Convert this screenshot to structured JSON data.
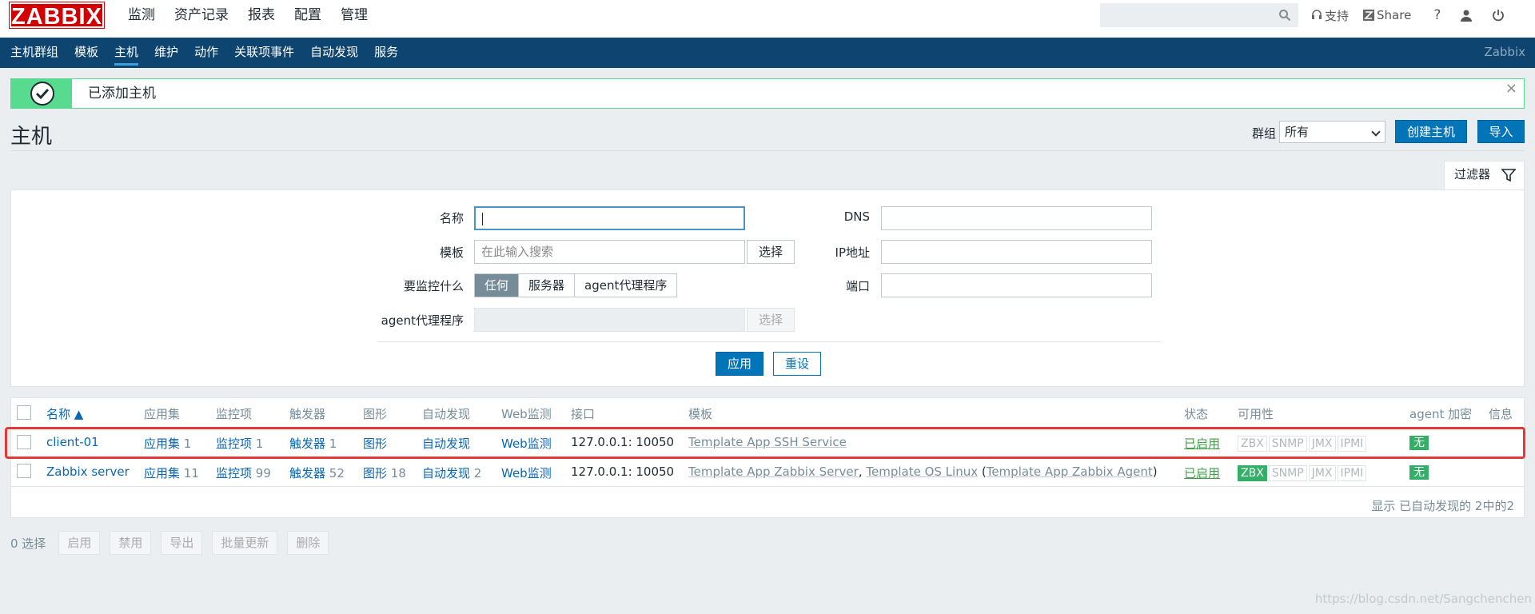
{
  "logo": "ZABBIX",
  "topnav": [
    "监测",
    "资产记录",
    "报表",
    "配置",
    "管理"
  ],
  "toplinks": {
    "support": "支持",
    "share": "Share",
    "help": "?"
  },
  "subnav": {
    "items": [
      "主机群组",
      "模板",
      "主机",
      "维护",
      "动作",
      "关联项事件",
      "自动发现",
      "服务"
    ],
    "brand": "Zabbix"
  },
  "message": {
    "text": "已添加主机",
    "close": "×"
  },
  "page": {
    "title": "主机",
    "group_label": "群组",
    "group_value": "所有",
    "create_button": "创建主机",
    "import_button": "导入"
  },
  "filter": {
    "tab_label": "过滤器",
    "name_label": "名称",
    "template_label": "模板",
    "template_placeholder": "在此输入搜索",
    "select_label": "选择",
    "monitored_by_label": "要监控什么",
    "monitored_by_options": [
      "任何",
      "服务器",
      "agent代理程序"
    ],
    "proxy_label": "agent代理程序",
    "dns_label": "DNS",
    "ip_label": "IP地址",
    "port_label": "端口",
    "apply": "应用",
    "reset": "重设"
  },
  "table": {
    "headers": {
      "name": "名称 ▲",
      "applications": "应用集",
      "items": "监控项",
      "triggers": "触发器",
      "graphs": "图形",
      "discovery": "自动发现",
      "web": "Web监测",
      "interface": "接口",
      "templates": "模板",
      "status": "状态",
      "availability": "可用性",
      "encryption": "agent 加密",
      "info": "信息"
    },
    "rows": [
      {
        "name": "client-01",
        "applications": "应用集",
        "applications_count": "1",
        "items": "监控项",
        "items_count": "1",
        "triggers": "触发器",
        "triggers_count": "1",
        "graphs": "图形",
        "graphs_count": "",
        "discovery": "自动发现",
        "discovery_count": "",
        "web": "Web监测",
        "interface": "127.0.0.1: 10050",
        "templates": "Template App SSH Service",
        "status": "已启用",
        "encryption": "无"
      },
      {
        "name": "Zabbix server",
        "applications": "应用集",
        "applications_count": "11",
        "items": "监控项",
        "items_count": "99",
        "triggers": "触发器",
        "triggers_count": "52",
        "graphs": "图形",
        "graphs_count": "18",
        "discovery": "自动发现",
        "discovery_count": "2",
        "web": "Web监测",
        "interface": "127.0.0.1: 10050",
        "templates_1": "Template App Zabbix Server",
        "templates_2": "Template OS Linux",
        "templates_3": "Template App Zabbix Agent",
        "status": "已启用",
        "encryption": "无"
      }
    ],
    "availability_labels": [
      "ZBX",
      "SNMP",
      "JMX",
      "IPMI"
    ],
    "footer": "显示 已自动发现的 2中的2"
  },
  "actions": {
    "selected": "0 选择",
    "buttons": [
      "启用",
      "禁用",
      "导出",
      "批量更新",
      "删除"
    ]
  },
  "watermark": "https://blog.csdn.net/Sangchenchen"
}
